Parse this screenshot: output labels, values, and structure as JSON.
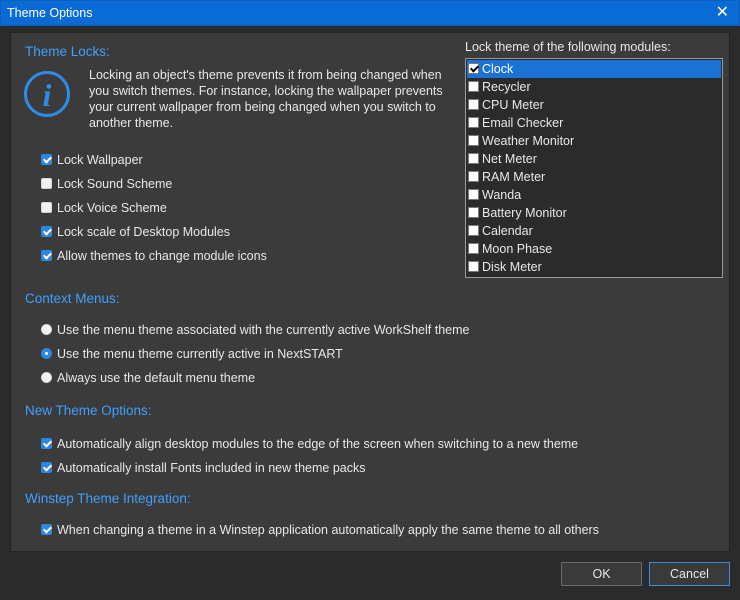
{
  "window": {
    "title": "Theme Options",
    "close_glyph": "✕"
  },
  "theme_locks": {
    "header": "Theme Locks:",
    "info_text": "Locking an object's theme prevents it from being changed when you switch themes. For instance, locking the wallpaper prevents your current wallpaper from being changed when you switch to another theme.",
    "info_icon": "info-icon",
    "info_glyph": "i",
    "options": [
      {
        "label": "Lock Wallpaper",
        "checked": true
      },
      {
        "label": "Lock Sound Scheme",
        "checked": false
      },
      {
        "label": "Lock Voice Scheme",
        "checked": false
      },
      {
        "label": "Lock scale of Desktop Modules",
        "checked": true
      },
      {
        "label": "Allow themes to change module icons",
        "checked": true
      }
    ]
  },
  "modules": {
    "header": "Lock theme of the following modules:",
    "items": [
      {
        "label": "Clock",
        "checked": true,
        "selected": true
      },
      {
        "label": "Recycler",
        "checked": false
      },
      {
        "label": "CPU Meter",
        "checked": false
      },
      {
        "label": "Email Checker",
        "checked": false
      },
      {
        "label": "Weather Monitor",
        "checked": false
      },
      {
        "label": "Net Meter",
        "checked": false
      },
      {
        "label": "RAM Meter",
        "checked": false
      },
      {
        "label": "Wanda",
        "checked": false
      },
      {
        "label": "Battery Monitor",
        "checked": false
      },
      {
        "label": "Calendar",
        "checked": false
      },
      {
        "label": "Moon Phase",
        "checked": false
      },
      {
        "label": "Disk Meter",
        "checked": false
      }
    ]
  },
  "context_menus": {
    "header": "Context Menus:",
    "options": [
      {
        "label": "Use the menu theme associated with the currently active WorkShelf theme",
        "selected": false
      },
      {
        "label": "Use the menu theme currently active in NextSTART",
        "selected": true
      },
      {
        "label": "Always use the default menu theme",
        "selected": false
      }
    ]
  },
  "new_theme_options": {
    "header": "New Theme Options:",
    "options": [
      {
        "label": "Automatically align desktop modules to the edge of the screen when switching to a new theme",
        "checked": true
      },
      {
        "label": "Automatically install Fonts included in new theme packs",
        "checked": true
      }
    ]
  },
  "integration": {
    "header": "Winstep Theme Integration:",
    "options": [
      {
        "label": "When changing a theme in a Winstep application automatically apply the same theme to all others",
        "checked": true
      }
    ]
  },
  "buttons": {
    "ok": "OK",
    "cancel": "Cancel"
  },
  "colors": {
    "accent": "#0b6bd6",
    "header": "#3ea0ff",
    "panel": "#3b3b3b",
    "background": "#2b2b2b"
  }
}
